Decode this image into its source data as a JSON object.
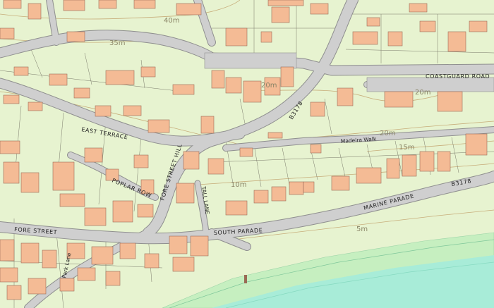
{
  "map": {
    "colors": {
      "land": "#e7f3d0",
      "building": "#f4bb95",
      "road": "#cfcfcf",
      "road_edge": "#8f8f8f",
      "beach": "#c6efc0",
      "sea": "#a8ecd8",
      "contour": "#c7ad7a",
      "text": "#333333"
    },
    "labels": {
      "coastguard_road": "COASTGUARD ROAD",
      "madeira_walk": "Madeira Walk",
      "b3178_north": "B3178",
      "b3178_east": "B3178",
      "east_terrace": "EAST TERRACE",
      "fore_street_hill": "FORE STREET HILL",
      "poplar_row": "POPLAR ROW",
      "marine_parade": "MARINE PARADE",
      "south_parade": "SOUTH PARADE",
      "fore_street": "FORE STREET",
      "park_lane": "Park Lane",
      "tall_lane": "TALL LANE"
    },
    "contours": {
      "c40": "40m",
      "c35": "35m",
      "c20a": "20m",
      "c20b": "20m",
      "c20c": "20m",
      "c15": "15m",
      "c10": "10m",
      "c5": "5m"
    }
  }
}
